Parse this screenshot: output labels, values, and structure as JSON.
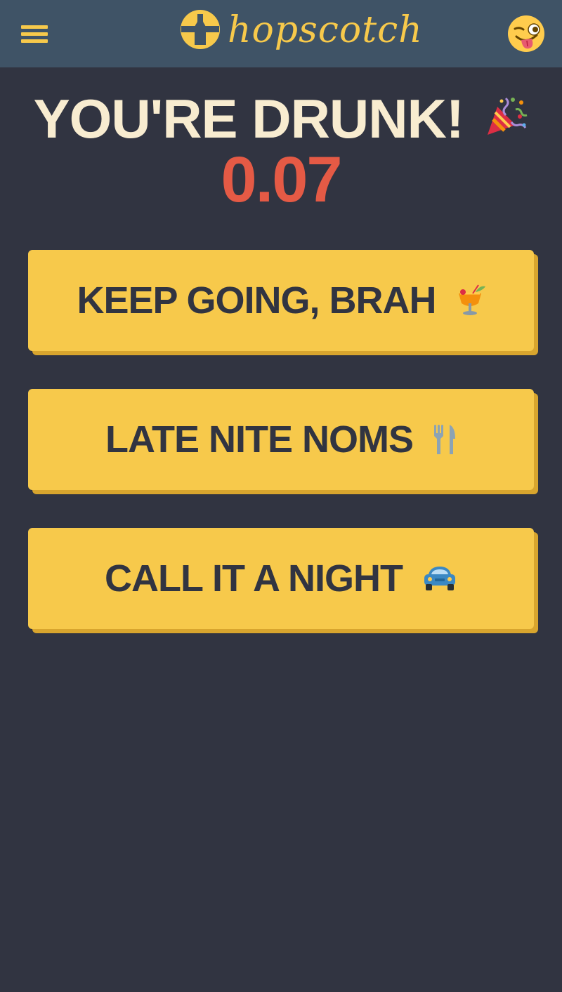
{
  "header": {
    "logo_text": "hopscotch",
    "menu_icon": "hamburger-menu-icon",
    "avatar_icon": "winking-face-with-tongue-emoji",
    "background_color": "#3f5366",
    "accent_color": "#f7c94b"
  },
  "status": {
    "title": "YOU'RE DRUNK!",
    "title_icon": "party-popper-emoji",
    "bac_value": "0.07",
    "bac_color": "#e55a45"
  },
  "actions": [
    {
      "label": "KEEP GOING, BRAH",
      "icon": "tropical-drink-emoji"
    },
    {
      "label": "LATE NITE NOMS",
      "icon": "fork-and-knife-icon"
    },
    {
      "label": "CALL IT A NIGHT",
      "icon": "car-emoji"
    }
  ],
  "theme": {
    "background": "#313441",
    "button_color": "#f7c94b",
    "button_text_color": "#313441"
  }
}
